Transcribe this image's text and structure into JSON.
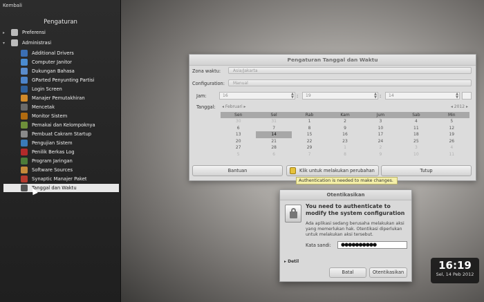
{
  "menu": {
    "back": "Kembali",
    "title": "Pengaturan",
    "categories": [
      {
        "label": "Preferensi",
        "expand": "▸"
      },
      {
        "label": "Administrasi",
        "expand": "▾"
      }
    ],
    "items": [
      {
        "label": "Additional Drivers",
        "color": "#3b6fb4",
        "icon": "chip-icon"
      },
      {
        "label": "Computer Janitor",
        "color": "#4a8bd0",
        "icon": "broom-icon"
      },
      {
        "label": "Dukungan Bahasa",
        "color": "#5a8ccc",
        "icon": "language-icon"
      },
      {
        "label": "GParted Penyunting Partisi",
        "color": "#4d84c9",
        "icon": "disk-icon"
      },
      {
        "label": "Login Screen",
        "color": "#2f5f99",
        "icon": "monitor-icon"
      },
      {
        "label": "Manajer Pemutakhiran",
        "color": "#d08a2b",
        "icon": "update-icon"
      },
      {
        "label": "Mencetak",
        "color": "#6a6a6a",
        "icon": "printer-icon"
      },
      {
        "label": "Monitor Sistem",
        "color": "#b06b10",
        "icon": "chart-icon"
      },
      {
        "label": "Pemakai dan Kelompoknya",
        "color": "#6e8f3a",
        "icon": "users-icon"
      },
      {
        "label": "Pembuat Cakram Startup",
        "color": "#8a8a8a",
        "icon": "usb-icon"
      },
      {
        "label": "Pengujian Sistem",
        "color": "#3a7ab8",
        "icon": "test-icon"
      },
      {
        "label": "Penilik Berkas Log",
        "color": "#b12a2a",
        "icon": "log-icon"
      },
      {
        "label": "Program Jaringan",
        "color": "#4b7b39",
        "icon": "network-icon"
      },
      {
        "label": "Software Sources",
        "color": "#c48a3a",
        "icon": "package-icon"
      },
      {
        "label": "Synaptic Manajer Paket",
        "color": "#b53b2f",
        "icon": "synaptic-icon"
      },
      {
        "label": "Tanggal dan Waktu",
        "color": "#555",
        "icon": "clock-icon",
        "selected": true
      }
    ]
  },
  "datewin": {
    "title": "Pengaturan Tanggal dan Waktu",
    "tz_label": "Zona waktu:",
    "tz_value": "Asia/Jakarta",
    "cfg_label": "Configuration:",
    "cfg_value": "Manual",
    "time_label": "Jam:",
    "hour": "16",
    "minute": "19",
    "second": "14",
    "date_label": "Tanggal:",
    "month": "Februari",
    "year": "2012",
    "weekdays": [
      "Sen",
      "Sel",
      "Rab",
      "Kam",
      "Jum",
      "Sab",
      "Min"
    ],
    "weeks": [
      [
        "30",
        "31",
        "1",
        "2",
        "3",
        "4",
        "5"
      ],
      [
        "6",
        "7",
        "8",
        "9",
        "10",
        "11",
        "12"
      ],
      [
        "13",
        "14",
        "15",
        "16",
        "17",
        "18",
        "19"
      ],
      [
        "20",
        "21",
        "22",
        "23",
        "24",
        "25",
        "26"
      ],
      [
        "27",
        "28",
        "29",
        "1",
        "2",
        "3",
        "4"
      ],
      [
        "5",
        "6",
        "7",
        "8",
        "9",
        "10",
        "11"
      ]
    ],
    "help": "Bantuan",
    "unlock": "Klik untuk melakukan perubahan",
    "close": "Tutup"
  },
  "tooltip": "Authentication is needed to make changes.",
  "auth": {
    "title": "Otentikasikan",
    "heading": "You need to authenticate to modify the system configuration",
    "desc": "Ada aplikasi sedang berusaha melakukan aksi yang memerlukan hak. Otentikasi diperlukan untuk melakukan aksi tersebut.",
    "pw_label": "Kata sandi:",
    "pw_value": "●●●●●●●●●●",
    "details": "Detil",
    "cancel": "Batal",
    "ok": "Otentikasikan"
  },
  "clock": {
    "time": "16:19",
    "date": "Sel, 14 Peb 2012"
  }
}
